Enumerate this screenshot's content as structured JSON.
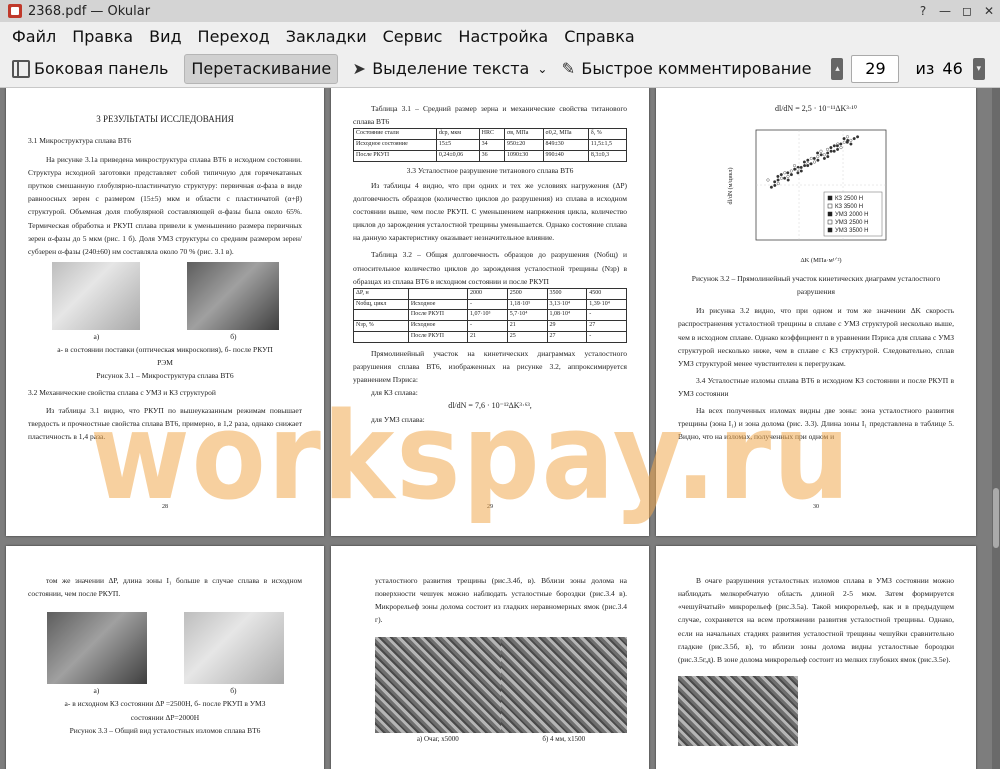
{
  "window": {
    "title": "2368.pdf  — Okular"
  },
  "menu": [
    "Файл",
    "Правка",
    "Вид",
    "Переход",
    "Закладки",
    "Сервис",
    "Настройка",
    "Справка"
  ],
  "toolbar": {
    "sidebar_label": "Боковая панель",
    "drag_label": "Перетаскивание",
    "select_label": "Выделение текста",
    "comment_label": "Быстрое комментирование",
    "page_current": "29",
    "page_of": "из",
    "page_total": "46"
  },
  "watermark": "workspay.ru",
  "pages": {
    "p28": {
      "heading": "3 РЕЗУЛЬТАТЫ ИССЛЕДОВАНИЯ",
      "sub1": "3.1 Микроструктура сплава ВТ6",
      "para1": "На рисунке 3.1а приведена микроструктура сплава ВТ6 в исходном состоянии. Структура исходной заготовки представляет собой типичную для горячекатаных прутков смешанную глобулярно-пластинчатую структуру: первичная α-фаза в виде равноосных зерен с размером (15±5) мкм и области с пластинчатой (α+β) структурой. Объемная доля глобулярной составляющей α-фазы была около 65%. Термическая обработка и РКУП сплава привели к уменьшению размера первичных зерен α-фазы до 5 мкм (рис. 1 б). Доля УМЗ структуры со средним размером зерен/субзерен α-фазы (240±60) нм составляла около 70 % (рис. 3.1 в).",
      "cap_a": "а)",
      "cap_b": "б)",
      "cap_line": "а- в состоянии поставки (оптическая микроскопия), б- после РКУП",
      "cap_line2": "РЭМ",
      "figcap": "Рисунок 3.1 – Микроструктура сплава ВТ6",
      "sub2": "3.2 Механические свойства сплава с УМЗ и КЗ структурой",
      "para2": "Из таблицы 3.1 видно, что РКУП по вышеуказанным режимам повышает твердость и прочностные свойства сплава ВТ6, примерно, в 1,2 раза, однако снижает пластичность в 1,4 раза.",
      "num": "28"
    },
    "p29": {
      "tcap1": "Таблица 3.1 – Средний размер зерна и механические свойства титанового сплава ВТ6",
      "t1": [
        [
          "Состояние стали",
          "dср, мкм",
          "HRC",
          "σв, МПа",
          "σ0,2, МПа",
          "δ, %"
        ],
        [
          "Исходное состояние",
          "15±5",
          "34",
          "950±20",
          "849±30",
          "11,5±1,5"
        ],
        [
          "После РКУП",
          "0,24±0,06",
          "36",
          "1090±30",
          "990±40",
          "8,3±0,3"
        ]
      ],
      "sub": "3.3 Усталостное разрушение титанового сплава ВТ6",
      "para1": "Из таблицы 4 видно, что при одних и тех же условиях нагружения (ΔP) долговечность образцов (количество циклов до разрушения) из сплава в исходном состоянии выше, чем после РКУП. С уменьшением напряжения цикла, количество циклов до зарождения усталостной трещины уменьшается. Однако состояние сплава на данную характеристику оказывает незначительное влияние.",
      "tcap2": "Таблица 3.2 – Общая долговечность образцов до разрушения (Nобщ) и относительное количество циклов до зарождения усталостной трещины (Nзр) в образцах из сплава ВТ6 в исходном состоянии и после РКУП",
      "t2": [
        [
          "ΔP, н",
          "",
          "2000",
          "2500",
          "3500",
          "4500"
        ],
        [
          "Nобщ, цикл",
          "Исходное",
          "-",
          "1,18·10⁵",
          "3,13·10⁴",
          "1,39·10⁴"
        ],
        [
          "",
          "После РКУП",
          "1,07·10⁵",
          "5,7·10⁴",
          "1,08·10⁴",
          "-"
        ],
        [
          "Nзр, %",
          "Исходное",
          "-",
          "21",
          "29",
          "27"
        ],
        [
          "",
          "После РКУП",
          "21",
          "25",
          "27",
          "-"
        ]
      ],
      "para2": "Прямолинейный участок на кинетических диаграммах усталостного разрушения сплава ВТ6, изображенных на рисунке 3.2, аппроксимируется уравнением Пэриса:",
      "kz": "для КЗ сплава:",
      "eq1": "dl/dN = 7,6 · 10⁻¹²ΔK³·⁶³,",
      "umz": "для УМЗ сплава:",
      "num": "29"
    },
    "p30": {
      "eq": "dl/dN = 2,5 · 10⁻¹¹ΔK³·¹⁰",
      "chart_ylabel": "dl/dN (м/цикл)",
      "chart_xlabel": "ΔK (МПа·м¹ᐟ²)",
      "legend": [
        "КЗ 2500 Н",
        "КЗ 3500 Н",
        "УМЗ 2000 Н",
        "УМЗ 2500 Н",
        "УМЗ 3500 Н"
      ],
      "figcap": "Рисунок 3.2 – Прямолинейный участок кинетических диаграмм усталостного разрушения",
      "para1": "Из рисунка 3.2 видно, что при одном и том же значении ΔK скорость распространения усталостной трещины в сплаве с УМЗ структурой несколько выше, чем в исходном сплаве. Однако коэффициент n в уравнении Пэриса для сплава с УМЗ структурой несколько ниже, чем в сплаве с КЗ структурой. Следовательно, сплав УМЗ структурой менее чувствителен к перегрузкам.",
      "sub": "3.4 Усталостные изломы сплава ВТ6 в исходном КЗ состоянии и после РКУП в УМЗ состоянии",
      "para2": "На всех полученных изломах видны две зоны: зона усталостного развития трещины (зона I₁) и зона долома (рис. 3.3). Длина зоны I₁ представлена в таблице 5. Видно, что на изломах, полученных при одном и",
      "num": "30"
    },
    "p31": {
      "para": "том же значении ΔP, длина зоны I₁ больше в случае сплава в исходном состоянии, чем после РКУП.",
      "cap_a": "а)",
      "cap_b": "б)",
      "cap_line": "а- в исходном КЗ состоянии ΔP =2500Н, б- после РКУП в УМЗ",
      "cap_line2": "состоянии ΔP=2000Н",
      "figcap": "Рисунок 3.3 – Общий вид усталостных изломов сплава ВТ6"
    },
    "p32": {
      "para": "усталостного развития трещины (рис.3.4б, в). Вблизи зоны долома на поверхности чешуек можно наблюдать усталостные бороздки (рис.3.4 в). Микрорельеф зоны долома состоит из гладких неравномерных ямок (рис.3.4 г).",
      "cap_a": "а) Очаг, х5000",
      "cap_b": "б) 4 мм, х1500"
    },
    "p33": {
      "para": "В очаге разрушения усталостных изломов сплава в УМЗ состоянии можно наблюдать мелкоребчатую область длиной 2-5 мкм. Затем формируется «чешуйчатый» микрорельеф (рис.3.5а). Такой микрорельеф, как и в предыдущем случае, сохраняется на всем протяжении развития усталостной трещины. Однако, если на начальных стадиях развития усталостной трещины чешуйки сравнительно гладкие (рис.3.5б, в), то вблизи зоны долома видны усталостные бороздки (рис.3.5г,д). В зоне долома микрорельеф состоит из мелких глубоких ямок (рис.3.5е)."
    }
  }
}
